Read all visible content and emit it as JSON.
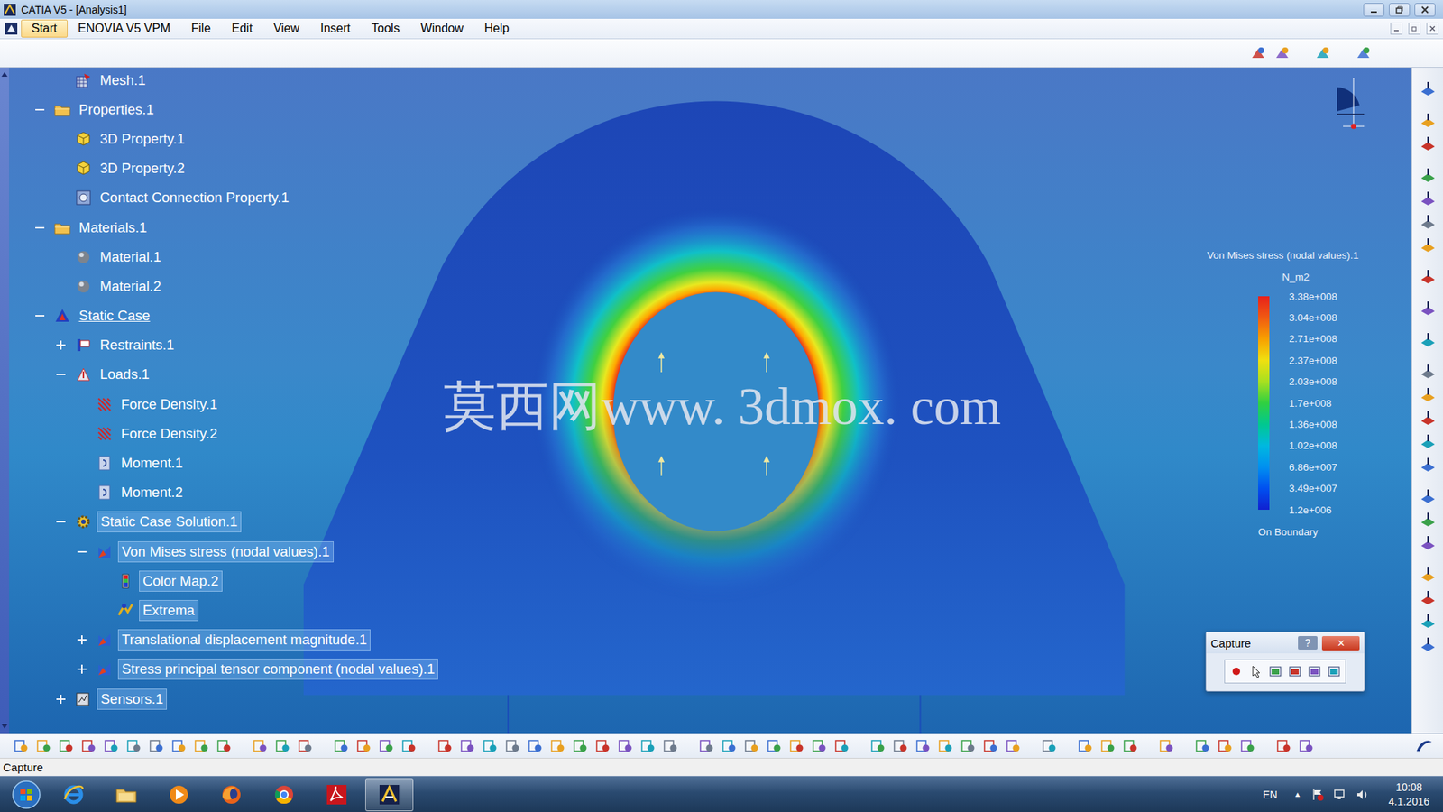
{
  "window": {
    "title": "CATIA V5 - [Analysis1]"
  },
  "menu": [
    {
      "label": "Start",
      "selected": true
    },
    {
      "label": "ENOVIA V5 VPM",
      "selected": false
    },
    {
      "label": "File",
      "selected": false
    },
    {
      "label": "Edit",
      "selected": false
    },
    {
      "label": "View",
      "selected": false
    },
    {
      "label": "Insert",
      "selected": false
    },
    {
      "label": "Tools",
      "selected": false
    },
    {
      "label": "Window",
      "selected": false
    },
    {
      "label": "Help",
      "selected": false
    }
  ],
  "tree": [
    {
      "label": "Mesh.1",
      "depth": 2,
      "kind": "mesh",
      "expandable": false,
      "expanded": false,
      "highlighted": false,
      "current": false
    },
    {
      "label": "Properties.1",
      "depth": 1,
      "kind": "folder",
      "expandable": true,
      "expanded": true,
      "highlighted": false,
      "current": false
    },
    {
      "label": "3D Property.1",
      "depth": 2,
      "kind": "property",
      "expandable": false,
      "expanded": false,
      "highlighted": false,
      "current": false
    },
    {
      "label": "3D Property.2",
      "depth": 2,
      "kind": "property",
      "expandable": false,
      "expanded": false,
      "highlighted": false,
      "current": false
    },
    {
      "label": "Contact Connection Property.1",
      "depth": 2,
      "kind": "contact",
      "expandable": false,
      "expanded": false,
      "highlighted": false,
      "current": false
    },
    {
      "label": "Materials.1",
      "depth": 1,
      "kind": "folder",
      "expandable": true,
      "expanded": true,
      "highlighted": false,
      "current": false
    },
    {
      "label": "Material.1",
      "depth": 2,
      "kind": "material",
      "expandable": false,
      "expanded": false,
      "highlighted": false,
      "current": false
    },
    {
      "label": "Material.2",
      "depth": 2,
      "kind": "material",
      "expandable": false,
      "expanded": false,
      "highlighted": false,
      "current": false
    },
    {
      "label": "Static Case",
      "depth": 1,
      "kind": "case",
      "expandable": true,
      "expanded": true,
      "highlighted": false,
      "current": true
    },
    {
      "label": "Restraints.1",
      "depth": 2,
      "kind": "restraint",
      "expandable": true,
      "expanded": false,
      "highlighted": false,
      "current": false
    },
    {
      "label": "Loads.1",
      "depth": 2,
      "kind": "loads",
      "expandable": true,
      "expanded": true,
      "highlighted": false,
      "current": false
    },
    {
      "label": "Force Density.1",
      "depth": 3,
      "kind": "force",
      "expandable": false,
      "expanded": false,
      "highlighted": false,
      "current": false
    },
    {
      "label": "Force Density.2",
      "depth": 3,
      "kind": "force",
      "expandable": false,
      "expanded": false,
      "highlighted": false,
      "current": false
    },
    {
      "label": "Moment.1",
      "depth": 3,
      "kind": "moment",
      "expandable": false,
      "expanded": false,
      "highlighted": false,
      "current": false
    },
    {
      "label": "Moment.2",
      "depth": 3,
      "kind": "moment",
      "expandable": false,
      "expanded": false,
      "highlighted": false,
      "current": false
    },
    {
      "label": "Static Case Solution.1",
      "depth": 2,
      "kind": "solution",
      "expandable": true,
      "expanded": true,
      "highlighted": true,
      "current": false
    },
    {
      "label": "Von Mises stress (nodal values).1",
      "depth": 3,
      "kind": "image",
      "expandable": true,
      "expanded": true,
      "highlighted": true,
      "current": false
    },
    {
      "label": "Color Map.2",
      "depth": 4,
      "kind": "colormap",
      "expandable": false,
      "expanded": false,
      "highlighted": true,
      "current": false
    },
    {
      "label": "Extrema",
      "depth": 4,
      "kind": "extrema",
      "expandable": false,
      "expanded": false,
      "highlighted": true,
      "current": false
    },
    {
      "label": "Translational displacement magnitude.1",
      "depth": 3,
      "kind": "image",
      "expandable": true,
      "expanded": false,
      "highlighted": true,
      "current": false
    },
    {
      "label": "Stress principal tensor component (nodal values).1",
      "depth": 3,
      "kind": "image",
      "expandable": true,
      "expanded": false,
      "highlighted": true,
      "current": false
    },
    {
      "label": "Sensors.1",
      "depth": 2,
      "kind": "sensors",
      "expandable": true,
      "expanded": false,
      "highlighted": true,
      "current": false
    }
  ],
  "watermark": "莫西网www. 3dmox. com",
  "legend": {
    "title": "Von Mises stress (nodal values).1",
    "unit": "N_m2",
    "values": [
      {
        "label": "3.38e+008",
        "color": "#e8201a"
      },
      {
        "label": "3.04e+008",
        "color": "#f05a12"
      },
      {
        "label": "2.71e+008",
        "color": "#f8a000"
      },
      {
        "label": "2.37e+008",
        "color": "#f0e010"
      },
      {
        "label": "2.03e+008",
        "color": "#a8e020"
      },
      {
        "label": "1.7e+008",
        "color": "#30d040"
      },
      {
        "label": "1.36e+008",
        "color": "#00c890"
      },
      {
        "label": "1.02e+008",
        "color": "#00b8e0"
      },
      {
        "label": "6.86e+007",
        "color": "#0090f0"
      },
      {
        "label": "3.49e+007",
        "color": "#0050f0"
      },
      {
        "label": "1.2e+006",
        "color": "#1020d0"
      }
    ],
    "footer": "On Boundary"
  },
  "capture": {
    "title": "Capture",
    "help": "?",
    "close": "✕"
  },
  "status_bar": "Capture",
  "taskbar": {
    "apps": [
      {
        "kind": "ie",
        "active": false
      },
      {
        "kind": "explorer",
        "active": false
      },
      {
        "kind": "media",
        "active": false
      },
      {
        "kind": "firefox",
        "active": false
      },
      {
        "kind": "chrome",
        "active": false
      },
      {
        "kind": "acrobat",
        "active": false
      },
      {
        "kind": "catia",
        "active": true
      }
    ],
    "language": "EN",
    "tray_arrow": "▲",
    "time": "10:08",
    "date": "4.1.2016"
  }
}
